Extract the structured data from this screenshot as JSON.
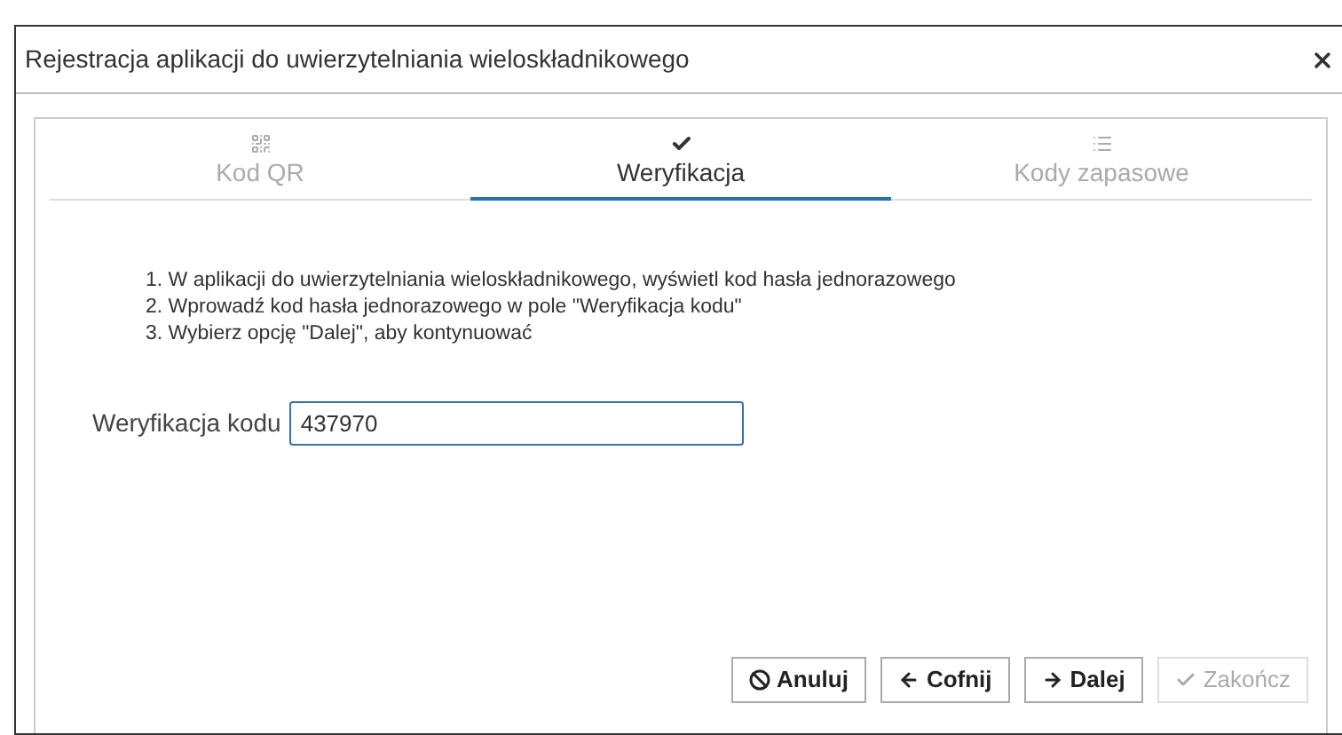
{
  "window": {
    "title": "Rejestracja aplikacji do uwierzytelniania wieloskładnikowego"
  },
  "tabs": [
    {
      "label": "Kod QR",
      "kind": "qr",
      "selected": false
    },
    {
      "label": "Weryfikacja",
      "kind": "check",
      "selected": true
    },
    {
      "label": "Kody zapasowe",
      "kind": "list",
      "selected": false
    }
  ],
  "instructions": [
    "1. W aplikacji do uwierzytelniania wieloskładnikowego, wyświetl kod hasła jednorazowego",
    "2. Wprowadź kod hasła jednorazowego w pole \"Weryfikacja kodu\"",
    "3. Wybierz opcję \"Dalej\", aby kontynuować"
  ],
  "field": {
    "label": "Weryfikacja kodu",
    "value": "437970"
  },
  "buttons": [
    {
      "label": "Anuluj",
      "kind": "cancel",
      "disabled": false
    },
    {
      "label": "Cofnij",
      "kind": "back",
      "disabled": false
    },
    {
      "label": "Dalej",
      "kind": "next",
      "disabled": false
    },
    {
      "label": "Zakończ",
      "kind": "finish",
      "disabled": true
    }
  ]
}
